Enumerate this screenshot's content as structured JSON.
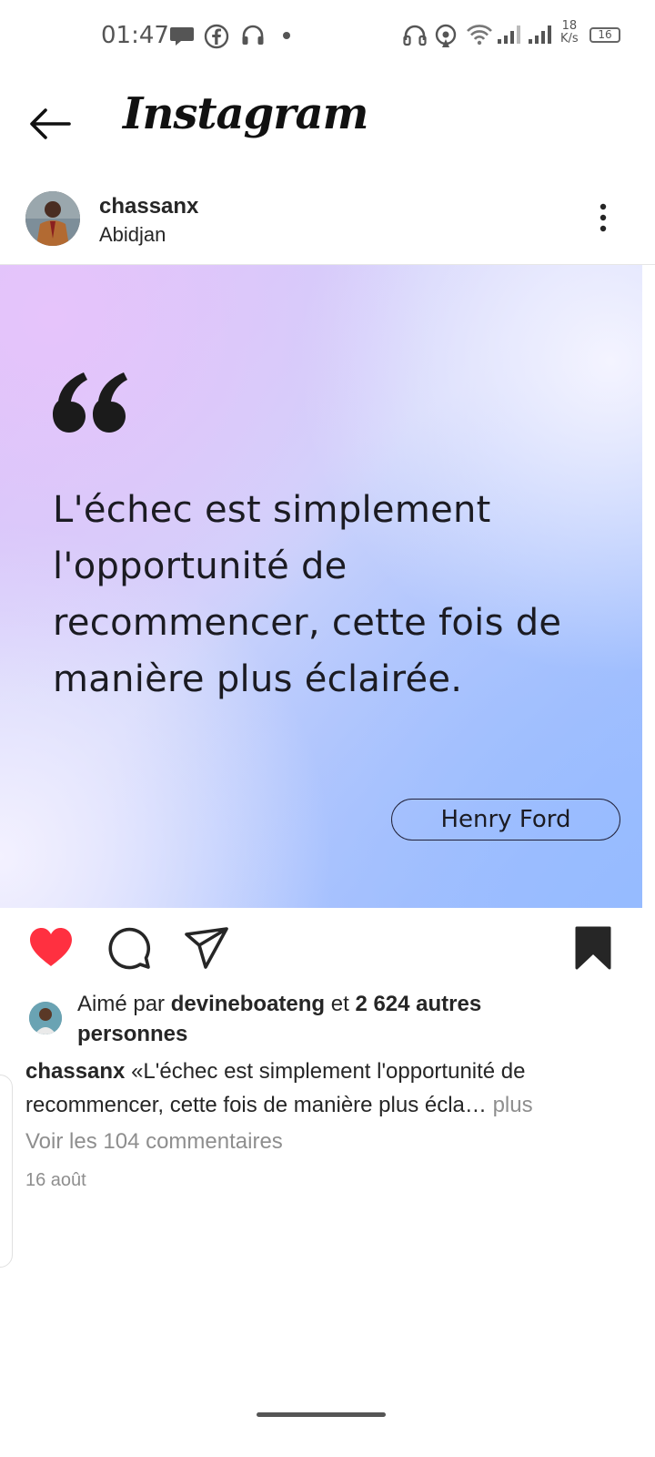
{
  "status_bar": {
    "time": "01:47",
    "net_speed_value": "18",
    "net_speed_unit": "K/s",
    "battery": "16"
  },
  "header": {
    "title": "Instagram"
  },
  "post": {
    "username": "chassanx",
    "location": "Abidjan",
    "image": {
      "quote": "L'échec est simplement l'opportunité de recommencer, cette fois de manière plus éclairée.",
      "author": "Henry Ford"
    },
    "likes": {
      "prefix": "Aimé par",
      "liker": "devineboateng",
      "joiner": "et",
      "others": "2 624 autres personnes"
    },
    "caption": {
      "username": "chassanx",
      "text": "«L'échec est simplement l'opportunité de recommencer, cette fois de manière plus écla…",
      "more": "plus"
    },
    "comments_link": "Voir les 104 commentaires",
    "date": "16 août"
  },
  "colors": {
    "like_red": "#ff3040",
    "text": "#262626",
    "muted": "#8e8e8e"
  }
}
